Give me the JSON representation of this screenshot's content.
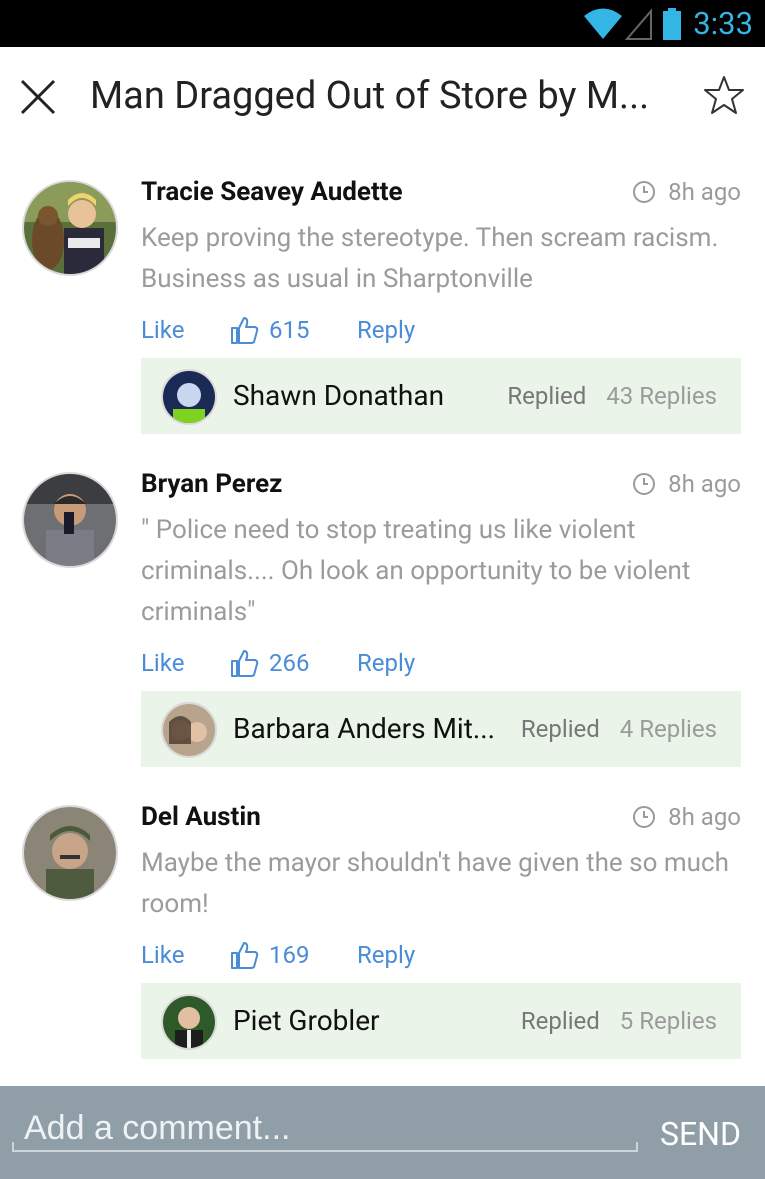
{
  "status_bar": {
    "time": "3:33"
  },
  "header": {
    "title": "Man Dragged Out of Store by M..."
  },
  "comments": [
    {
      "author": "Tracie Seavey Audette",
      "time": "8h ago",
      "text": "Keep proving the stereotype. Then scream racism. Business as usual in Sharptonville",
      "like_label": "Like",
      "likes": "615",
      "reply_label": "Reply",
      "reply_preview": {
        "name": "Shawn Donathan",
        "replied_label": "Replied",
        "replies_count": "43 Replies"
      }
    },
    {
      "author": "Bryan Perez",
      "time": "8h ago",
      "text": "\" Police need to stop treating us like violent criminals.... Oh look an opportunity to be violent criminals\"",
      "like_label": "Like",
      "likes": "266",
      "reply_label": "Reply",
      "reply_preview": {
        "name": "Barbara Anders Mit...",
        "replied_label": "Replied",
        "replies_count": "4 Replies"
      }
    },
    {
      "author": "Del Austin",
      "time": "8h ago",
      "text": "Maybe the mayor shouldn't have given the so much room!",
      "like_label": "Like",
      "likes": "169",
      "reply_label": "Reply",
      "reply_preview": {
        "name": "Piet Grobler",
        "replied_label": "Replied",
        "replies_count": "5 Replies"
      }
    }
  ],
  "footer": {
    "placeholder": "Add a comment...",
    "send_label": "SEND"
  },
  "colors": {
    "accent": "#4a8cd6",
    "status_clock": "#33b5e5",
    "reply_bg": "#eaf4e8",
    "footer_bg": "#8f9ea7"
  }
}
